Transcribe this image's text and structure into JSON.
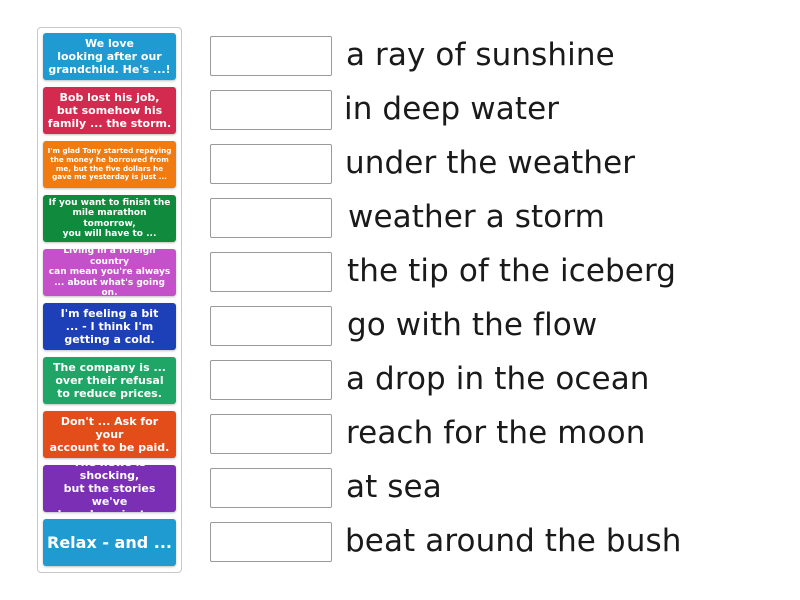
{
  "tiles": [
    {
      "text": "We love\nlooking after our\ngrandchild. He's ...!",
      "color": "#1f9bd1",
      "size": "s11"
    },
    {
      "text": "Bob lost his job,\nbut somehow his\nfamily ... the storm.",
      "color": "#d32a4f",
      "size": "s11"
    },
    {
      "text": "I'm glad Tony started repaying\nthe money he borrowed from\nme, but the five dollars he\ngave me yesterday is just ...",
      "color": "#f07b11",
      "size": "s7"
    },
    {
      "text": "If you want to finish the\nmile marathon tomorrow,\nyou will have to ...",
      "color": "#108a3c",
      "size": "s9"
    },
    {
      "text": "Living in a foreign country\ncan mean you're always\n... about what's going on.",
      "color": "#c451c9",
      "size": "s9"
    },
    {
      "text": "I'm feeling a bit\n... - I think I'm\ngetting a cold.",
      "color": "#1d3fb8",
      "size": "s11"
    },
    {
      "text": "The company is ...\nover their refusal\nto reduce prices.",
      "color": "#1fa566",
      "size": "s11"
    },
    {
      "text": "Don't ... Ask for your\naccount to be paid.",
      "color": "#e24d1a",
      "size": "s11"
    },
    {
      "text": "The news is shocking,\nbut the stories we've\nheard are just ...",
      "color": "#7a2fb5",
      "size": "s11"
    },
    {
      "text": "Relax - and ...",
      "color": "#1f9bd1",
      "size": "s17"
    }
  ],
  "phrases": [
    "a ray of sunshine",
    "in deep water",
    "under the weather",
    "weather a storm",
    "the tip of the iceberg",
    "go with the flow",
    "a drop in the ocean",
    "reach for the moon",
    "at sea",
    "beat around the bush"
  ]
}
